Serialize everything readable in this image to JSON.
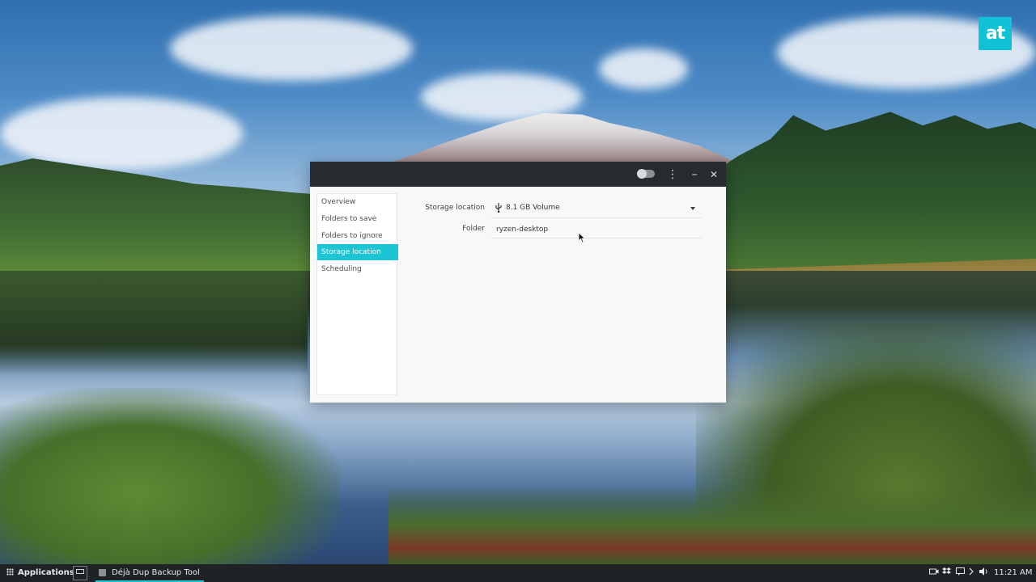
{
  "wallpaper": {
    "logo_text": "at",
    "logo_color": "#11c2d6"
  },
  "window": {
    "title_controls": {
      "menu_icon": "⋮",
      "minimize_icon": "–",
      "close_icon": "✕"
    },
    "sidebar": {
      "items": [
        {
          "label": "Overview",
          "active": false
        },
        {
          "label": "Folders to save",
          "active": false
        },
        {
          "label": "Folders to ignore",
          "active": false
        },
        {
          "label": "Storage location",
          "active": true
        },
        {
          "label": "Scheduling",
          "active": false
        }
      ]
    },
    "form": {
      "storage_label": "Storage location",
      "storage_value": "8.1 GB Volume",
      "folder_label": "Folder",
      "folder_value": "ryzen-desktop"
    },
    "accent_color": "#1cc4d4"
  },
  "taskbar": {
    "applications_label": "Applications",
    "task_label": "Déjà Dup Backup Tool",
    "clock": "11:21 AM"
  }
}
